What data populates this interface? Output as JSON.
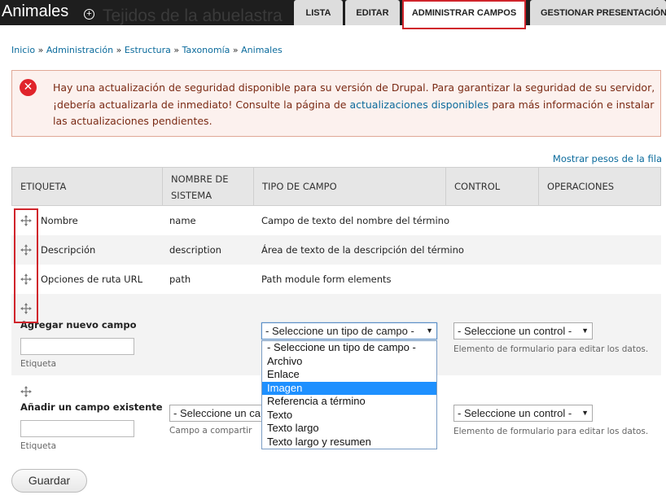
{
  "header": {
    "title": "Animales",
    "background_text": "Tejidos de la abuelastra",
    "tabs": [
      "LISTA",
      "EDITAR",
      "ADMINISTRAR CAMPOS",
      "GESTIONAR PRESENTACIÓN"
    ],
    "active_tab": "ADMINISTRAR CAMPOS"
  },
  "breadcrumb": {
    "items": [
      "Inicio",
      "Administración",
      "Estructura",
      "Taxonomía",
      "Animales"
    ],
    "separator": " » "
  },
  "message": {
    "text_before_link": "Hay una actualización de seguridad disponible para su versión de Drupal. Para garantizar la seguridad de su servidor, ¡debería actualizarla de inmediato! Consulte la página de ",
    "link_text": "actualizaciones disponibles",
    "text_after_link": " para más información e instalar las actualizaciones pendientes."
  },
  "show_weights_link": "Mostrar pesos de la fila",
  "table": {
    "headers": [
      "ETIQUETA",
      "NOMBRE DE SISTEMA",
      "TIPO DE CAMPO",
      "CONTROL",
      "OPERACIONES"
    ],
    "rows": [
      {
        "label": "Nombre",
        "machine": "name",
        "type": "Campo de texto del nombre del término"
      },
      {
        "label": "Descripción",
        "machine": "description",
        "type": "Área de texto de la descripción del término"
      },
      {
        "label": "Opciones de ruta URL",
        "machine": "path",
        "type": "Path module form elements"
      }
    ]
  },
  "new_field": {
    "heading": "Agregar nuevo campo",
    "label_caption": "Etiqueta",
    "type_select": "- Seleccione un tipo de campo -",
    "widget_select": "- Seleccione un control -",
    "widget_desc": "Elemento de formulario para editar los datos."
  },
  "existing_field": {
    "heading": "Añadir un campo existente",
    "label_caption": "Etiqueta",
    "field_select": "- Seleccione un ca",
    "field_desc": "Campo a compartir",
    "widget_select": "- Seleccione un control -",
    "widget_desc": "Elemento de formulario para editar los datos."
  },
  "dropdown": {
    "options": [
      "- Seleccione un tipo de campo -",
      "Archivo",
      "Enlace",
      "Imagen",
      "Referencia a término",
      "Texto",
      "Texto largo",
      "Texto largo y resumen"
    ],
    "highlighted": "Imagen"
  },
  "save_button": "Guardar",
  "colors": {
    "accent_link": "#0b6b9c",
    "highlight_red": "#d0242b",
    "error_bg": "#fcf1ee",
    "dropdown_selected": "#1e90ff"
  }
}
